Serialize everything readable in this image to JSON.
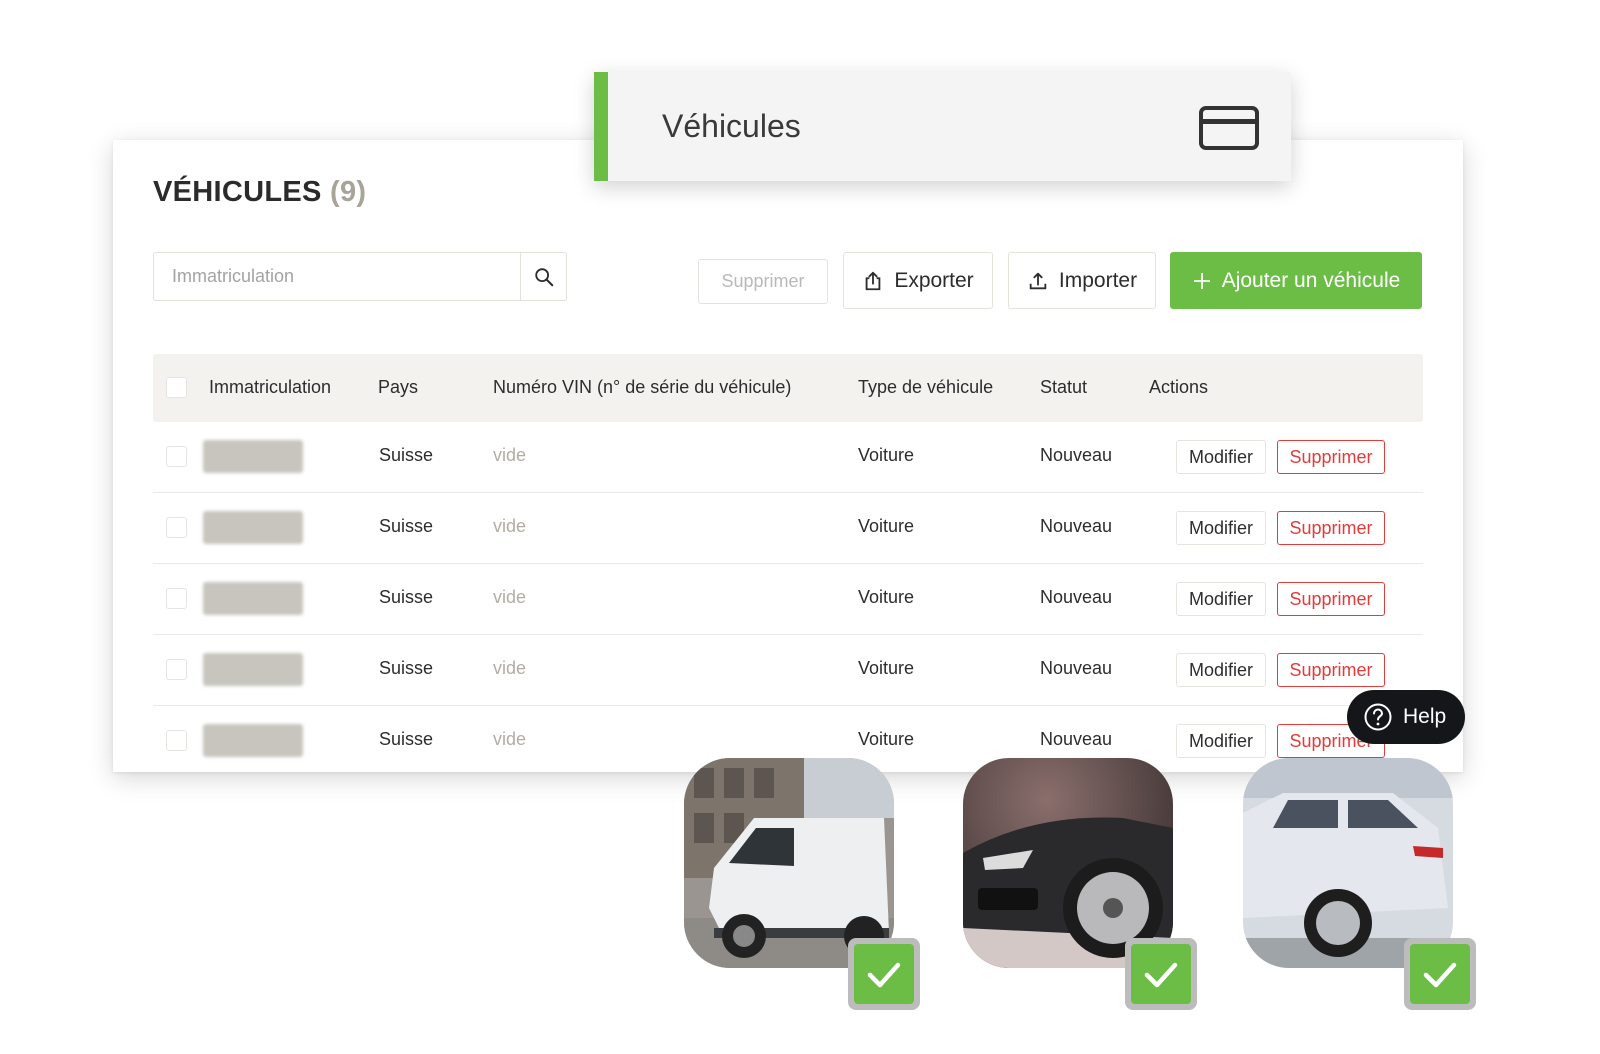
{
  "header_pill": {
    "title": "Véhicules",
    "icon": "card-icon"
  },
  "page": {
    "title": "VÉHICULES",
    "count": "(9)"
  },
  "search": {
    "placeholder": "Immatriculation",
    "icon": "search-icon"
  },
  "toolbar": {
    "delete_label": "Supprimer",
    "export_label": "Exporter",
    "import_label": "Importer",
    "add_label": "Ajouter un véhicule"
  },
  "table": {
    "columns": [
      "Immatriculation",
      "Pays",
      "Numéro VIN (n° de série du véhicule)",
      "Type de véhicule",
      "Statut",
      "Actions"
    ],
    "rows": [
      {
        "pays": "Suisse",
        "vin": "vide",
        "type": "Voiture",
        "statut": "Nouveau",
        "edit": "Modifier",
        "delete": "Supprimer"
      },
      {
        "pays": "Suisse",
        "vin": "vide",
        "type": "Voiture",
        "statut": "Nouveau",
        "edit": "Modifier",
        "delete": "Supprimer"
      },
      {
        "pays": "Suisse",
        "vin": "vide",
        "type": "Voiture",
        "statut": "Nouveau",
        "edit": "Modifier",
        "delete": "Supprimer"
      },
      {
        "pays": "Suisse",
        "vin": "vide",
        "type": "Voiture",
        "statut": "Nouveau",
        "edit": "Modifier",
        "delete": "Supprimer"
      },
      {
        "pays": "Suisse",
        "vin": "vide",
        "type": "Voiture",
        "statut": "Nouveau",
        "edit": "Modifier",
        "delete": "Supprimer"
      }
    ]
  },
  "help": {
    "label": "Help"
  },
  "colors": {
    "accent": "#6cbd45",
    "danger": "#e23b3b",
    "header_bg": "#f3f2ef",
    "help_bg": "#14161a"
  }
}
